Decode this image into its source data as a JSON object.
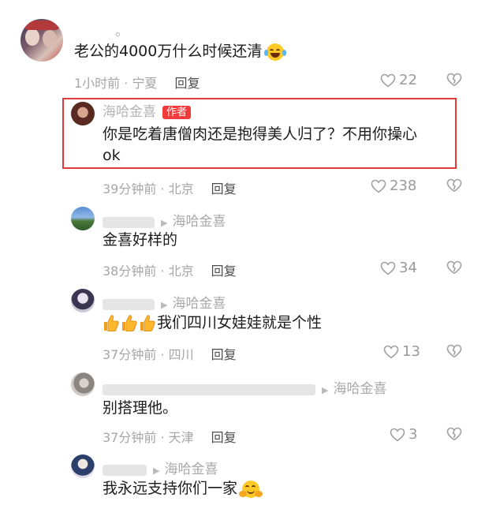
{
  "comments": [
    {
      "name": "。",
      "text": "老公的4000万什么时候还清",
      "time": "1小时前 · 宁夏",
      "reply_label": "回复",
      "likes": "22"
    },
    {
      "name": "海哈金喜",
      "author_tag": "作者",
      "text_line1": "你是吃着唐僧肉还是抱得美人归了？不用你操心",
      "text_line2": "ok",
      "time": "39分钟前 · 北京",
      "reply_label": "回复",
      "likes": "238"
    },
    {
      "reply_to": "海哈金喜",
      "text": "金喜好样的",
      "time": "38分钟前 · 北京",
      "reply_label": "回复",
      "likes": "34"
    },
    {
      "reply_to": "海哈金喜",
      "text": "我们四川女娃娃就是个性",
      "time": "37分钟前 · 四川",
      "reply_label": "回复",
      "likes": "13"
    },
    {
      "reply_to": "海哈金喜",
      "text": "别搭理他。",
      "time": "37分钟前 · 天津",
      "reply_label": "回复",
      "likes": "3"
    },
    {
      "reply_to": "海哈金喜",
      "text": "我永远支持你们一家"
    }
  ],
  "highlight_color": "#e23b3b",
  "author_tag_color": "#f23b3b"
}
